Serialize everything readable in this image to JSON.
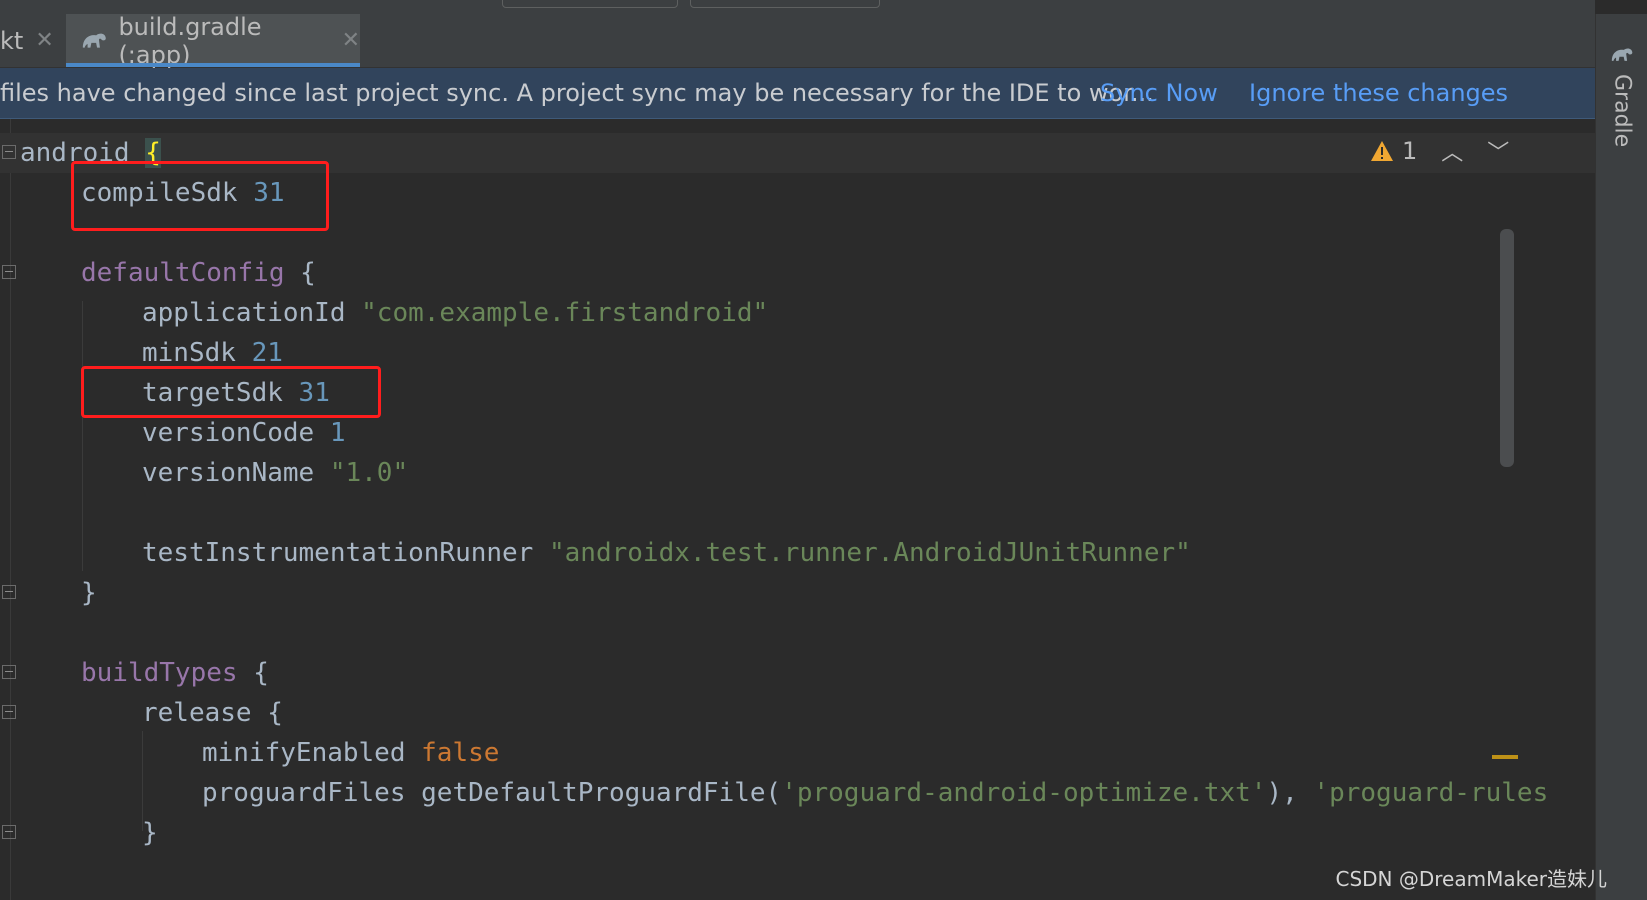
{
  "tabs": [
    {
      "label": "kt",
      "active": false
    },
    {
      "label": "build.gradle (:app)",
      "active": true
    }
  ],
  "banner": {
    "message": "files have changed since last project sync. A project sync may be necessary for the IDE to wor...",
    "sync_now": "Sync Now",
    "ignore": "Ignore these changes"
  },
  "right_panel": {
    "label": "Gradle",
    "icon": "gradle-elephant-icon"
  },
  "inspection": {
    "warning_count": "1",
    "icon": "warning-triangle-icon"
  },
  "code": {
    "l1": "android",
    "l1_brace": "{",
    "l2_key": "compileSdk",
    "l2_val": "31",
    "l4_key": "defaultConfig",
    "l4_brace": "{",
    "l5_key": "applicationId",
    "l5_val": "\"com.example.firstandroid\"",
    "l6_key": "minSdk",
    "l6_val": "21",
    "l7_key": "targetSdk",
    "l7_val": "31",
    "l8_key": "versionCode",
    "l8_val": "1",
    "l9_key": "versionName",
    "l9_val": "\"1.0\"",
    "l11_key": "testInstrumentationRunner",
    "l11_val": "\"androidx.test.runner.AndroidJUnitRunner\"",
    "l12": "}",
    "l14_key": "buildTypes",
    "l14_brace": "{",
    "l15_key": "release",
    "l15_brace": "{",
    "l16_key": "minifyEnabled",
    "l16_val": "false",
    "l17_key": "proguardFiles",
    "l17_call": "getDefaultProguardFile(",
    "l17_arg1": "'proguard-android-optimize.txt'",
    "l17_sep": "), ",
    "l17_arg2": "'proguard-rules",
    "l18": "}"
  },
  "colors": {
    "background": "#2b2b2b",
    "keyword": "#cc7832",
    "number": "#6897bb",
    "string": "#6a8759",
    "method": "#9876aa",
    "highlight_box": "#ff1d1d",
    "link": "#589df6"
  },
  "watermark": "CSDN @DreamMaker造妹儿"
}
